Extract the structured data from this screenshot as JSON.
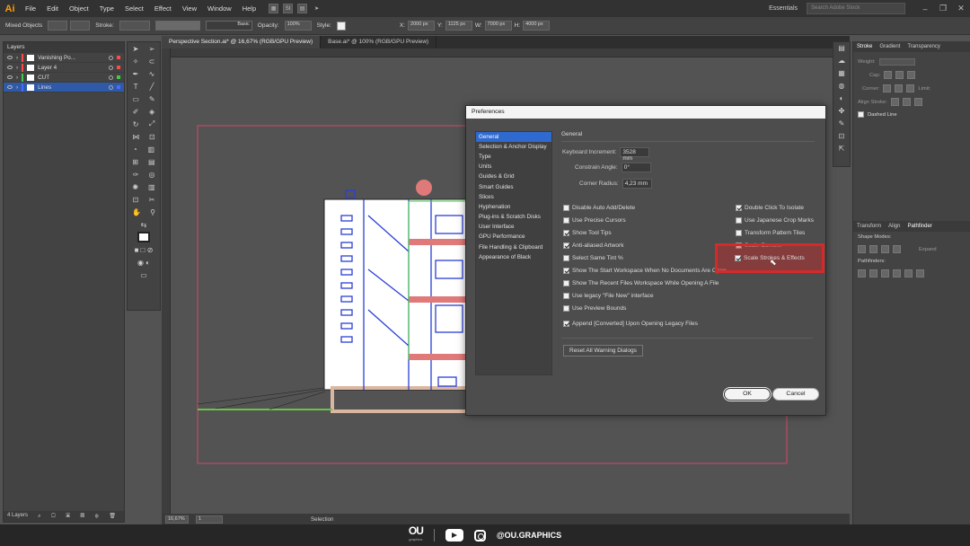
{
  "menubar": {
    "logo": "Ai",
    "items": [
      "File",
      "Edit",
      "Object",
      "Type",
      "Select",
      "Effect",
      "View",
      "Window",
      "Help"
    ],
    "workspace": "Essentials",
    "search_placeholder": "Search Adobe Stock"
  },
  "control_bar": {
    "selection": "Mixed Objects",
    "stroke_label": "Stroke:",
    "brush": "Basic",
    "opacity_label": "Opacity:",
    "opacity": "100%",
    "style_label": "Style:",
    "x": "2000 px",
    "y": "1125 px",
    "w": "7000 px",
    "h": "4000 px"
  },
  "doc_tabs": [
    {
      "label": "Perspective Section.ai* @ 16,67% (RGB/GPU Preview)",
      "active": true
    },
    {
      "label": "Base.ai* @ 100% (RGB/GPU Preview)",
      "active": false
    }
  ],
  "layers_panel": {
    "title": "Layers",
    "layers": [
      {
        "name": "Vanishing Po...",
        "color": "#ff4a4a"
      },
      {
        "name": "Layer 4",
        "color": "#ff4a4a"
      },
      {
        "name": "CUT",
        "color": "#3ecf3e"
      },
      {
        "name": "Lines",
        "color": "#4a6bff"
      }
    ],
    "footer": "4 Layers"
  },
  "status_bar": {
    "zoom": "16,67%",
    "page": "1",
    "tool": "Selection"
  },
  "preferences": {
    "title": "Preferences",
    "categories": [
      "General",
      "Selection & Anchor Display",
      "Type",
      "Units",
      "Guides & Grid",
      "Smart Guides",
      "Slices",
      "Hyphenation",
      "Plug-ins & Scratch Disks",
      "User Interface",
      "GPU Performance",
      "File Handling & Clipboard",
      "Appearance of Black"
    ],
    "selected_category": "General",
    "section_title": "General",
    "keyboard_increment_label": "Keyboard Increment:",
    "keyboard_increment": "3528 mm",
    "constrain_angle_label": "Constrain Angle:",
    "constrain_angle": "0°",
    "corner_radius_label": "Corner Radius:",
    "corner_radius": "4,23 mm",
    "left_options": [
      {
        "label": "Disable Auto Add/Delete",
        "checked": false
      },
      {
        "label": "Use Precise Cursors",
        "checked": false
      },
      {
        "label": "Show Tool Tips",
        "checked": true
      },
      {
        "label": "Anti-aliased Artwork",
        "checked": true
      },
      {
        "label": "Select Same Tint %",
        "checked": false
      },
      {
        "label": "Show The Start Workspace When No Documents Are Open",
        "checked": true
      },
      {
        "label": "Show The Recent Files Workspace While Opening A File",
        "checked": false
      },
      {
        "label": "Use legacy \"File New\" interface",
        "checked": false
      },
      {
        "label": "Use Preview Bounds",
        "checked": false
      },
      {
        "label": "Append [Converted] Upon Opening Legacy Files",
        "checked": true
      }
    ],
    "right_options": [
      {
        "label": "Double Click To Isolate",
        "checked": true
      },
      {
        "label": "Use Japanese Crop Marks",
        "checked": false
      },
      {
        "label": "Transform Pattern Tiles",
        "checked": false
      },
      {
        "label": "Scale Corners",
        "checked": false
      },
      {
        "label": "Scale Strokes & Effects",
        "checked": true
      }
    ],
    "reset_button": "Reset All Warning Dialogs",
    "ok": "OK",
    "cancel": "Cancel"
  },
  "right_panel": {
    "tabs1": [
      "Stroke",
      "Gradient",
      "Transparency"
    ],
    "weight_label": "Weight:",
    "cap_label": "Cap:",
    "corner_label": "Corner:",
    "limit_label": "Limit:",
    "align_label": "Align Stroke:",
    "dashed_label": "Dashed Line",
    "tabs2": [
      "Transform",
      "Align",
      "Pathfinder"
    ],
    "shape_modes": "Shape Modes:",
    "expand": "Expand",
    "pathfinders": "Pathfinders:"
  },
  "branding": {
    "logo": "OU",
    "sub": "graphics",
    "handle": "@OU.GRAPHICS"
  },
  "colors": {
    "accent": "#2f6ad0",
    "highlight": "#d42a2a"
  }
}
